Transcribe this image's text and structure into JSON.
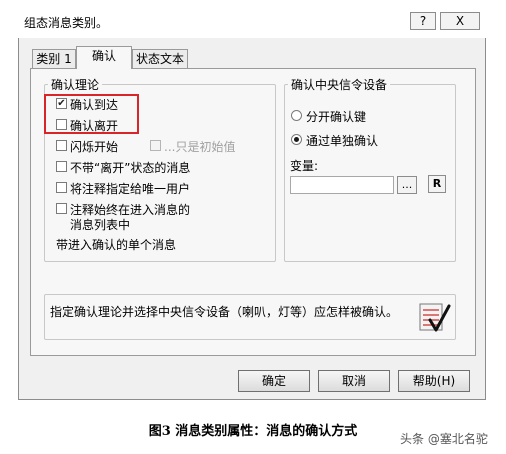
{
  "window": {
    "title": "组态消息类别。",
    "help_button": "?",
    "close_button": "X"
  },
  "tabs": [
    {
      "label": "类别 1"
    },
    {
      "label": "确认"
    },
    {
      "label": "状态文本"
    }
  ],
  "ack_group": {
    "legend": "确认理论",
    "options": [
      {
        "label": "确认到达",
        "checked": true
      },
      {
        "label": "确认离开",
        "checked": false
      },
      {
        "label": "闪烁开始",
        "checked": false
      },
      {
        "label": "...只是初始值",
        "checked": false,
        "disabled": true
      },
      {
        "label": "不带“离开”状态的消息",
        "checked": false
      },
      {
        "label": "将注释指定给唯一用户",
        "checked": false
      },
      {
        "label": "注释始终在进入消息的",
        "label_line2": "消息列表中",
        "checked": false
      }
    ],
    "footer": "带进入确认的单个消息"
  },
  "central_group": {
    "legend": "确认中央信令设备",
    "radios": [
      {
        "label": "分开确认键",
        "selected": false
      },
      {
        "label": "通过单独确认",
        "selected": true
      }
    ],
    "variable_label": "变量:",
    "variable_value": "",
    "browse_button": "...",
    "r_button": "R"
  },
  "info": {
    "text": "指定确认理论并选择中央信令设备（喇叭，灯等）应怎样被确认。",
    "icon": "checklist-icon"
  },
  "buttons": {
    "ok": "确定",
    "cancel": "取消",
    "help": "帮助(H)"
  },
  "caption": "图3  消息类别属性：消息的确认方式",
  "watermark": "头条 @塞北名驼"
}
